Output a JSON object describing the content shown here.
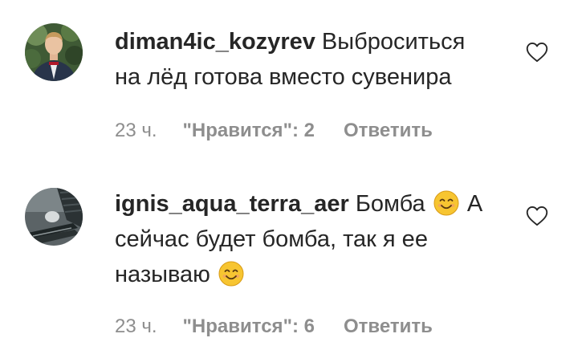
{
  "colors": {
    "text": "#262626",
    "meta": "#8e8e8e",
    "background": "#ffffff"
  },
  "comments": [
    {
      "username": "diman4ic_kozyrev",
      "text_line1": "Выброситься",
      "text_line2": "на лёд готова вместо сувенира",
      "time": "23 ч.",
      "likes": "\"Нравится\": 2",
      "reply": "Ответить",
      "avatar_icon": "avatar-photo",
      "like_icon": "heart-outline-icon"
    },
    {
      "username": "ignis_aqua_terra_aer",
      "text_part1": "Бомба",
      "text_part2": "А",
      "text_line2": "сейчас будет бомба, так я ее",
      "text_line3": "называю",
      "time": "23 ч.",
      "likes": "\"Нравится\": 6",
      "reply": "Ответить",
      "emoji_icon": "smiling-face-emoji",
      "avatar_icon": "avatar-photo",
      "like_icon": "heart-outline-icon"
    }
  ]
}
